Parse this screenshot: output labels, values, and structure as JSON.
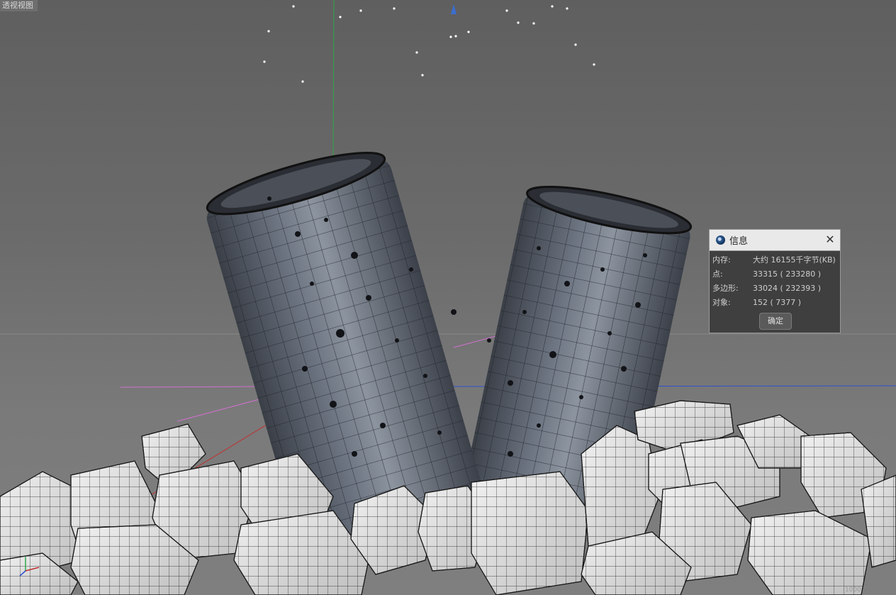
{
  "viewport": {
    "label": "透视视图",
    "watermark": "1000"
  },
  "info_dialog": {
    "title": "信息",
    "rows": [
      {
        "key": "内存:",
        "value": "大约 16155千字节(KB)"
      },
      {
        "key": "点:",
        "value": "33315 ( 233280 )"
      },
      {
        "key": "多边形:",
        "value": "33024 ( 232393 )"
      },
      {
        "key": "对象:",
        "value": "152 ( 7377 )"
      }
    ],
    "ok_label": "确定"
  },
  "colors": {
    "viewport_bg": "#6b6b6b",
    "can_body": "#5b6370",
    "ice": "#e6e6e6",
    "wire": "#111111",
    "axis_y": "#2da84a",
    "axis_x": "#c03030",
    "axis_z": "#3050d0",
    "spline": "#d070d0"
  },
  "icons": [
    "close-icon",
    "cinema4d-logo-icon",
    "camera-axis-icon"
  ]
}
